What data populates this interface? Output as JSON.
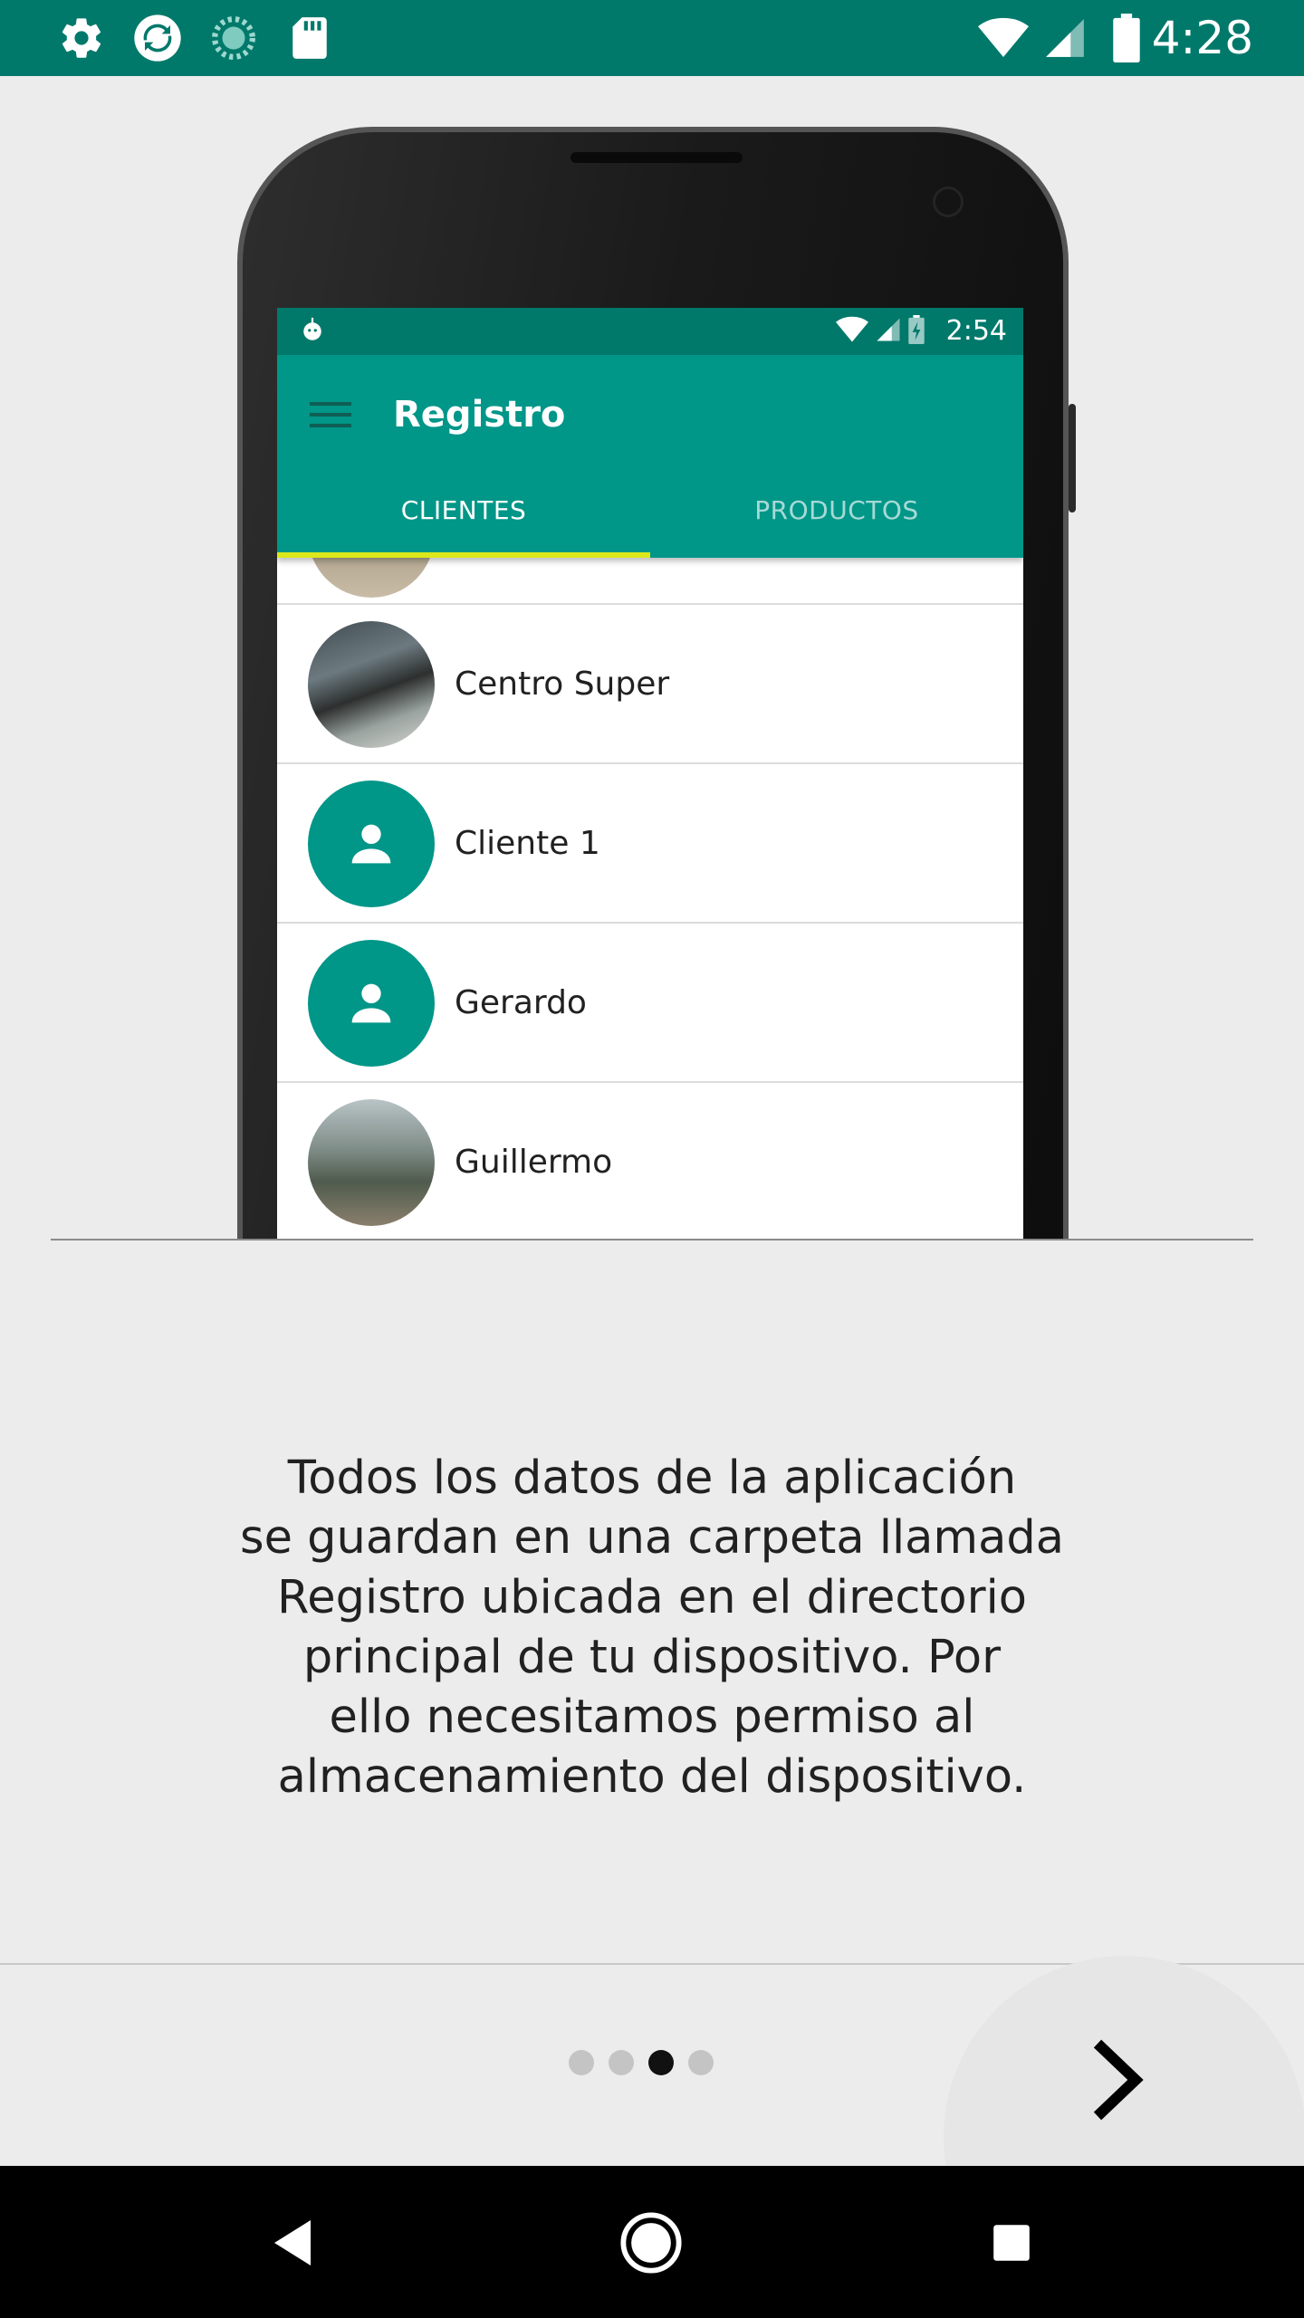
{
  "status_bar": {
    "time": "4:28",
    "icons": [
      "gear-icon",
      "sync-app-icon",
      "loading-app-icon",
      "sd-card-icon",
      "wifi-icon",
      "signal-icon",
      "battery-icon"
    ]
  },
  "illustration": {
    "app_status_time": "2:54",
    "app_title": "Registro",
    "tabs": [
      {
        "label": "CLIENTES",
        "active": true
      },
      {
        "label": "PRODUCTOS",
        "active": false
      }
    ],
    "clients": [
      {
        "name": "Centro Super",
        "avatar": "photo"
      },
      {
        "name": "Cliente 1",
        "avatar": "person-icon"
      },
      {
        "name": "Gerardo",
        "avatar": "person-icon"
      },
      {
        "name": "Guillermo",
        "avatar": "photo"
      }
    ],
    "colors": {
      "primary": "#009688",
      "primary_dark": "#00796b",
      "tab_indicator": "#dce81a"
    }
  },
  "description": "Todos los datos de la aplicación\nse guardan en una carpeta llamada\nRegistro ubicada en el directorio\nprincipal de tu dispositivo. Por\nello necesitamos permiso al\nalmacenamiento del dispositivo.",
  "pager": {
    "total": 4,
    "current": 3
  },
  "next_button": {
    "icon": "chevron-right-icon"
  },
  "nav_bar": {
    "icons": [
      "back-icon",
      "home-icon",
      "recents-icon"
    ]
  }
}
